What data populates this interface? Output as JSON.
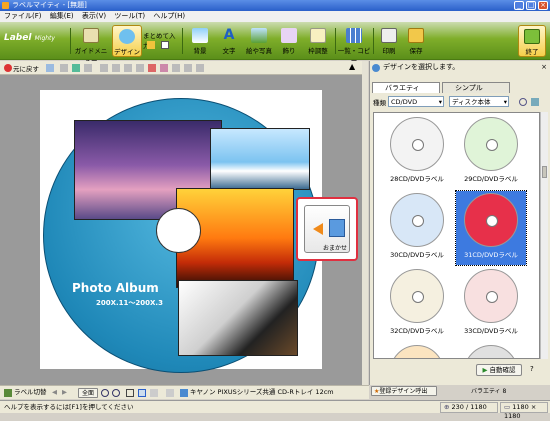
{
  "window": {
    "title": "ラベルマイティ - [無題]",
    "minimize": "_",
    "maximize": "□",
    "close": "×"
  },
  "menu": [
    "ファイル(F)",
    "編集(E)",
    "表示(V)",
    "ツール(T)",
    "ヘルプ(H)"
  ],
  "toolbar": {
    "logo_main": "Label",
    "logo_sub": "Mighty",
    "buttons": [
      {
        "label": "ガイドメニュー"
      },
      {
        "label": "デザイン"
      },
      {
        "label": "まとめて入力"
      },
      {
        "label": "背景"
      },
      {
        "label": "文字"
      },
      {
        "label": "絵や写真"
      },
      {
        "label": "飾り"
      },
      {
        "label": "枠調整"
      },
      {
        "label": "一覧・コピー"
      },
      {
        "label": "印刷"
      },
      {
        "label": "保存"
      },
      {
        "label": "終了"
      }
    ]
  },
  "subtoolbar": {
    "undo_label": "元に戻す"
  },
  "canvas": {
    "album_title": "Photo Album",
    "album_subtitle": "200X.11～200X.3",
    "omakase_label": "おまかせ"
  },
  "right_pane": {
    "header": "デザインを選択します。",
    "close": "×",
    "tabs": [
      {
        "label": "バラエティ"
      },
      {
        "label": "シンプル"
      }
    ],
    "type_label": "種類",
    "type_value": "CD/DVD",
    "subtype_value": "ディスク本体",
    "thumbnails": [
      {
        "name": "28CD/DVDラベル",
        "color": "#f3f3f3"
      },
      {
        "name": "29CD/DVDラベル",
        "color": "#e0f4d8"
      },
      {
        "name": "30CD/DVDラベル",
        "color": "#d8e7f7"
      },
      {
        "name": "31CD/DVDラベル",
        "color": "#e7304a"
      },
      {
        "name": "32CD/DVDラベル",
        "color": "#f5f0e0"
      },
      {
        "name": "33CD/DVDラベル",
        "color": "#f8e0e0"
      },
      {
        "name": "",
        "color": "#fbe4c0"
      },
      {
        "name": "",
        "color": "#e0e0e0"
      }
    ],
    "auto_update": "自動確認",
    "register_design": "登録デザイン呼出",
    "variety_count": "バラエティ 8"
  },
  "bottombar": {
    "label_switch": "ラベル切替",
    "zoom_all": "全面",
    "paper_info": "キヤノン PIXUSシリーズ共通 CD-Rトレイ 12cm"
  },
  "statusbar": {
    "help": "ヘルプを表示するには[F1]を押してください",
    "coords": "230 / 1180",
    "size": "1180 × 1180"
  }
}
